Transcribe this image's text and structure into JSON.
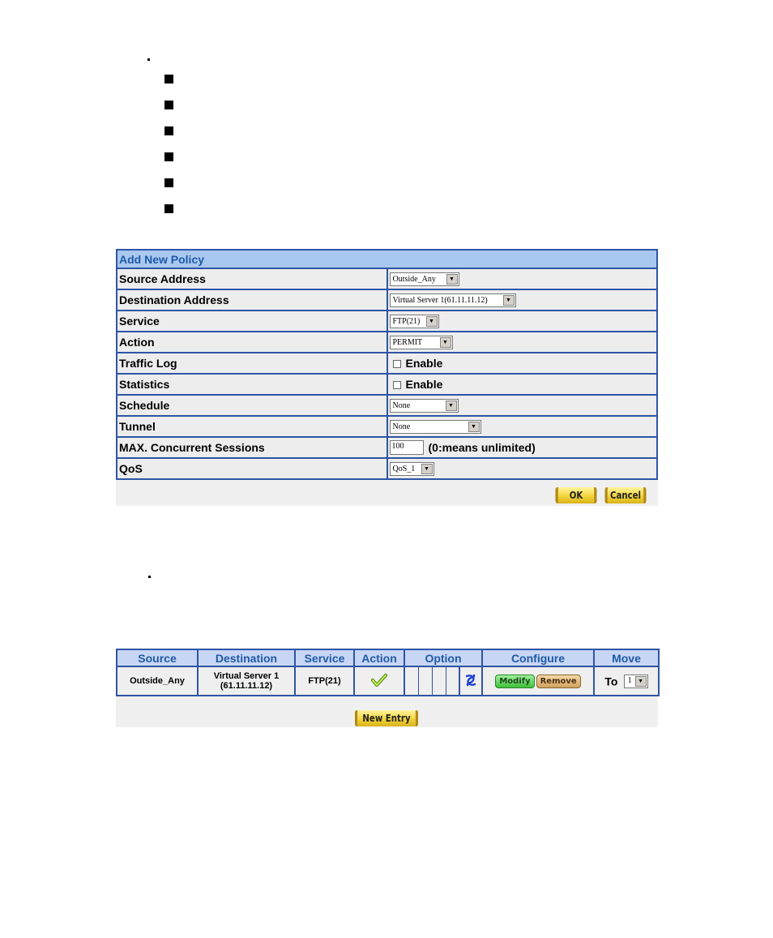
{
  "bullets": {
    "top_dots": 1,
    "list_items": 6,
    "second_dot": 1
  },
  "policy_form": {
    "title": "Add New Policy",
    "rows": [
      {
        "label": "Source Address",
        "type": "select",
        "value": "Outside_Any"
      },
      {
        "label": "Destination Address",
        "type": "select",
        "value": "Virtual Server 1(61.11.11.12)"
      },
      {
        "label": "Service",
        "type": "select",
        "value": "FTP(21)"
      },
      {
        "label": "Action",
        "type": "select",
        "value": "PERMIT"
      },
      {
        "label": "Traffic Log",
        "type": "checkbox",
        "value": "Enable",
        "checked": false
      },
      {
        "label": "Statistics",
        "type": "checkbox",
        "value": "Enable",
        "checked": false
      },
      {
        "label": "Schedule",
        "type": "select",
        "value": "None"
      },
      {
        "label": "Tunnel",
        "type": "select",
        "value": "None"
      },
      {
        "label": "MAX. Concurrent Sessions",
        "type": "number",
        "value": "100",
        "hint": "(0:means unlimited)"
      },
      {
        "label": "QoS",
        "type": "select",
        "value": "QoS_1"
      }
    ],
    "ok_label": "OK",
    "cancel_label": "Cancel"
  },
  "policy_list": {
    "headers": [
      "Source",
      "Destination",
      "Service",
      "Action",
      "Option",
      "Configure",
      "Move"
    ],
    "rows": [
      {
        "source": "Outside_Any",
        "destination_line1": "Virtual Server 1",
        "destination_line2": "(61.11.11.12)",
        "service": "FTP(21)",
        "action_icon": "permit-check-icon",
        "option_icon": "qos-link-icon",
        "modify_label": "Modify",
        "remove_label": "Remove",
        "move_prefix": "To",
        "move_value": "1"
      }
    ],
    "new_entry_label": "New Entry"
  },
  "colors": {
    "border_blue": "#2f55a4",
    "header_text_blue": "#1f5aa8",
    "title_bar": "#a9c8f0",
    "list_header": "#c7d6f5",
    "button_gold": "#f2d53a",
    "modify_green": "#3fbf3a",
    "remove_tan": "#d2a060"
  }
}
